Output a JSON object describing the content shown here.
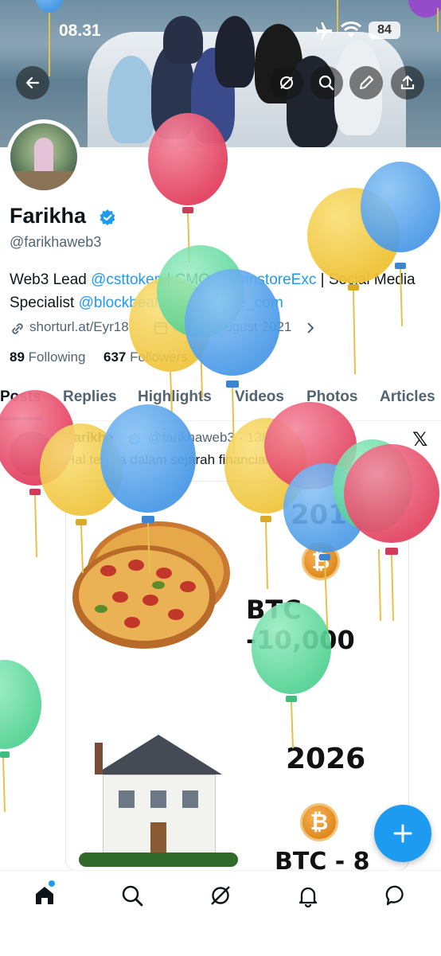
{
  "status_bar": {
    "time": "08.31",
    "battery": "84"
  },
  "header_actions": [
    "back-arrow-icon",
    "grok-icon",
    "search-icon",
    "edit-icon",
    "share-icon"
  ],
  "profile": {
    "name": "Farikha",
    "handle": "@farikhaweb3",
    "bio_prefix": "Web3 Lead ",
    "bio_link1": "@csttoken",
    "bio_mid": " | CMO ",
    "bio_link2": "@coinstoreExc",
    "bio_after": " | Social Media",
    "bio_line2_prefix": "Specialist ",
    "bio_link3": "@blockbeats",
    "bio_link4": "@swapbee_com",
    "website": "shorturl.at/Eyr18",
    "joined": "Joined August 2021",
    "following_count": "89",
    "following_label": "Following",
    "followers_count": "637",
    "followers_label": "Followers"
  },
  "tabs": [
    "Posts",
    "Replies",
    "Highlights",
    "Videos",
    "Photos",
    "Articles"
  ],
  "post": {
    "author": "Farikha",
    "handle": "@farikhaweb3 · 13h",
    "text": "Hal tergila dalam sejarah financial ind…",
    "media": {
      "year_top": "2010",
      "price_top": "BTC -10,000",
      "year_bottom": "2026",
      "price_bottom": "BTC - 8",
      "coin_symbol": "₿"
    }
  },
  "bottom_nav": [
    "home-icon",
    "search-icon",
    "grok-icon",
    "notifications-icon",
    "messages-icon"
  ],
  "colors": {
    "accent": "#1d9bf0",
    "balloon_red": "#e8506e",
    "balloon_yellow": "#f3cd47",
    "balloon_blue": "#5aa9ef",
    "balloon_green": "#66dba0"
  }
}
